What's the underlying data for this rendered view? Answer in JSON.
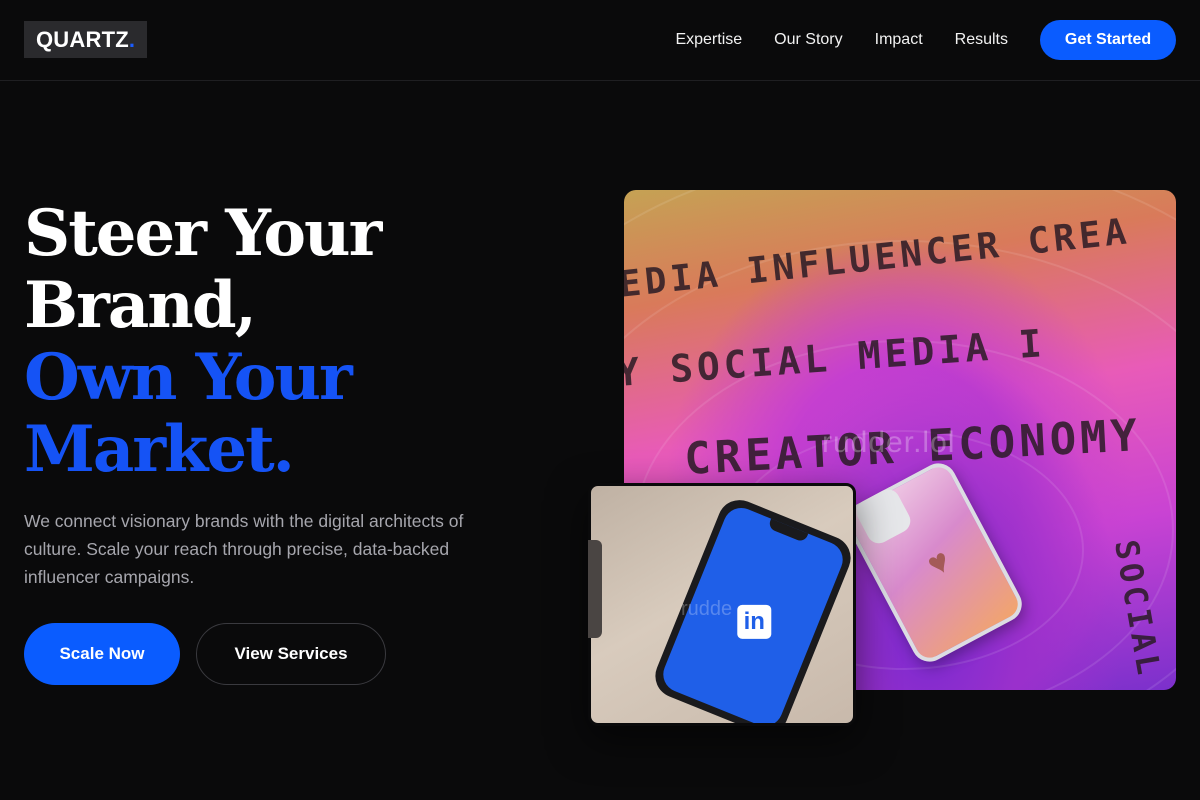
{
  "nav": {
    "logo_text": "QUARTZ",
    "logo_dot": ".",
    "links": [
      "Expertise",
      "Our Story",
      "Impact",
      "Results"
    ],
    "cta_label": "Get Started"
  },
  "hero": {
    "headline_line1": "Steer Your",
    "headline_line2": "Brand,",
    "headline_line3": "Own Your",
    "headline_line4": "Market.",
    "subtitle": "We connect visionary brands with the digital architects of culture. Scale your reach through precise, data-backed influencer campaigns.",
    "primary_button": "Scale Now",
    "secondary_button": "View Services"
  },
  "images": {
    "main_words": [
      "EDIA INFLUENCER CREA",
      "Y SOCIAL MEDIA I",
      "CREATOR ECONOMY",
      "SOCIAL"
    ],
    "main_watermark": "rudder.lol",
    "overlap_watermark": "rudde",
    "overlap_badge": "in"
  },
  "colors": {
    "accent": "#0a5cff",
    "headline_blue": "#1553f5",
    "background": "#0a0a0b"
  }
}
